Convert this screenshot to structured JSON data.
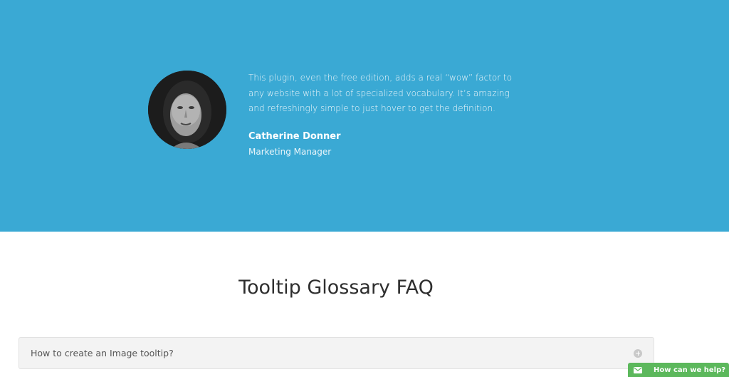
{
  "testimonial": {
    "quote": "This plugin, even the free edition, adds a real “wow” factor to any website with a lot of specialized vocabulary. It’s amazing and refreshingly simple to just hover to get the definition.",
    "author_name": "Catherine Donner",
    "author_role": "Marketing Manager",
    "background_color": "#3aa9d4"
  },
  "faq": {
    "heading": "Tooltip Glossary FAQ",
    "items": [
      {
        "question": "How to create an Image tooltip?",
        "icon": "plus-circle-icon"
      }
    ]
  },
  "help_widget": {
    "label": "How can we help?",
    "icon": "mail-icon",
    "color": "#5cb85c"
  }
}
